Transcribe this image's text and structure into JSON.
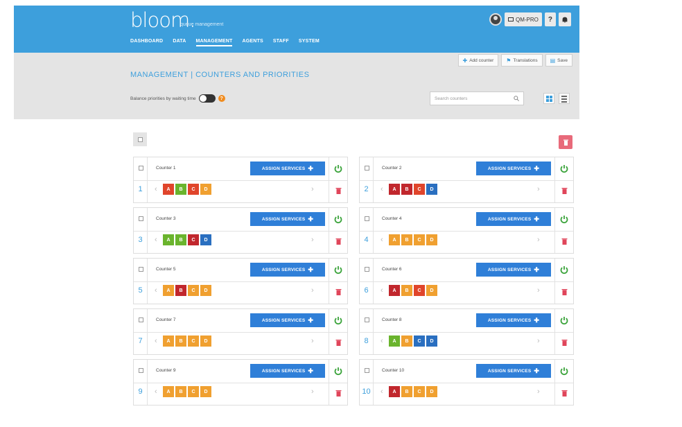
{
  "header": {
    "logo": "bloom.",
    "logo_sub": "queue management",
    "nav": [
      "DASHBOARD",
      "DATA",
      "MANAGEMENT",
      "AGENTS",
      "STAFF",
      "SYSTEM"
    ],
    "active_nav": 2,
    "user_btn": "QM-PRO",
    "help_btn": "?"
  },
  "toolbar": {
    "title": "MANAGEMENT | COUNTERS AND PRIORITIES",
    "balance_label": "Balance priorities by waiting time",
    "help_mark": "?",
    "add_counter": "Add counter",
    "translations": "Translations",
    "save": "Save",
    "search_placeholder": "Search counters"
  },
  "colors": {
    "green": "#6ab42d",
    "red": "#e0452b",
    "darkred": "#c1272d",
    "orange": "#f0a030",
    "blue": "#2a6fc0"
  },
  "assign_label": "ASSIGN SERVICES",
  "counters": [
    {
      "name": "Counter 1",
      "number": "1",
      "priorities": [
        {
          "letter": "A",
          "color": "red"
        },
        {
          "letter": "B",
          "color": "green"
        },
        {
          "letter": "C",
          "color": "red"
        },
        {
          "letter": "D",
          "color": "orange"
        }
      ]
    },
    {
      "name": "Counter 2",
      "number": "2",
      "priorities": [
        {
          "letter": "A",
          "color": "darkred"
        },
        {
          "letter": "B",
          "color": "darkred"
        },
        {
          "letter": "C",
          "color": "red"
        },
        {
          "letter": "D",
          "color": "blue"
        }
      ]
    },
    {
      "name": "Counter 3",
      "number": "3",
      "priorities": [
        {
          "letter": "A",
          "color": "green"
        },
        {
          "letter": "B",
          "color": "green"
        },
        {
          "letter": "C",
          "color": "darkred"
        },
        {
          "letter": "D",
          "color": "blue"
        }
      ]
    },
    {
      "name": "Counter 4",
      "number": "4",
      "priorities": [
        {
          "letter": "A",
          "color": "orange"
        },
        {
          "letter": "B",
          "color": "orange"
        },
        {
          "letter": "C",
          "color": "orange"
        },
        {
          "letter": "D",
          "color": "orange"
        }
      ]
    },
    {
      "name": "Counter 5",
      "number": "5",
      "priorities": [
        {
          "letter": "A",
          "color": "orange"
        },
        {
          "letter": "B",
          "color": "darkred"
        },
        {
          "letter": "C",
          "color": "orange"
        },
        {
          "letter": "D",
          "color": "orange"
        }
      ]
    },
    {
      "name": "Counter 6",
      "number": "6",
      "priorities": [
        {
          "letter": "A",
          "color": "darkred"
        },
        {
          "letter": "B",
          "color": "orange"
        },
        {
          "letter": "C",
          "color": "red"
        },
        {
          "letter": "D",
          "color": "orange"
        }
      ]
    },
    {
      "name": "Counter 7",
      "number": "7",
      "priorities": [
        {
          "letter": "A",
          "color": "orange"
        },
        {
          "letter": "B",
          "color": "orange"
        },
        {
          "letter": "C",
          "color": "orange"
        },
        {
          "letter": "D",
          "color": "orange"
        }
      ]
    },
    {
      "name": "Counter 8",
      "number": "8",
      "priorities": [
        {
          "letter": "A",
          "color": "green"
        },
        {
          "letter": "B",
          "color": "orange"
        },
        {
          "letter": "C",
          "color": "blue"
        },
        {
          "letter": "D",
          "color": "blue"
        }
      ]
    },
    {
      "name": "Counter 9",
      "number": "9",
      "priorities": [
        {
          "letter": "A",
          "color": "orange"
        },
        {
          "letter": "B",
          "color": "orange"
        },
        {
          "letter": "C",
          "color": "orange"
        },
        {
          "letter": "D",
          "color": "orange"
        }
      ]
    },
    {
      "name": "Counter 10",
      "number": "10",
      "priorities": [
        {
          "letter": "A",
          "color": "darkred"
        },
        {
          "letter": "B",
          "color": "orange"
        },
        {
          "letter": "C",
          "color": "orange"
        },
        {
          "letter": "D",
          "color": "orange"
        }
      ]
    }
  ]
}
